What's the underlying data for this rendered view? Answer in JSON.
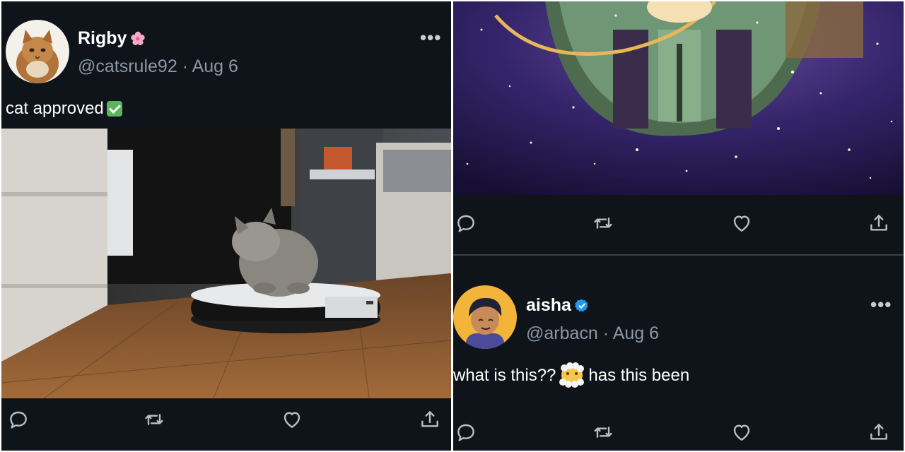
{
  "tweet_left": {
    "author_name": "Rigby",
    "handle": "@catsrule92",
    "date": "Aug 6",
    "text": "cat approved",
    "more_label": "•••"
  },
  "tweet_right_bottom": {
    "author_name": "aisha",
    "handle": "@arbacn",
    "date": "Aug 6",
    "text_before_emoji": "what is this??",
    "text_after_emoji": "has this been",
    "more_label": "•••"
  },
  "separator": "·",
  "icons": {
    "reply": "speech-bubble-icon",
    "retweet": "retweet-arrows-icon",
    "like": "heart-icon",
    "share": "share-upload-icon",
    "name_badge": "cherry-blossom-icon",
    "verified": "verified-check-icon"
  },
  "colors": {
    "background": "#0f141a",
    "secondary_text": "#8b98a5",
    "verified_blue": "#1d9bf0"
  }
}
